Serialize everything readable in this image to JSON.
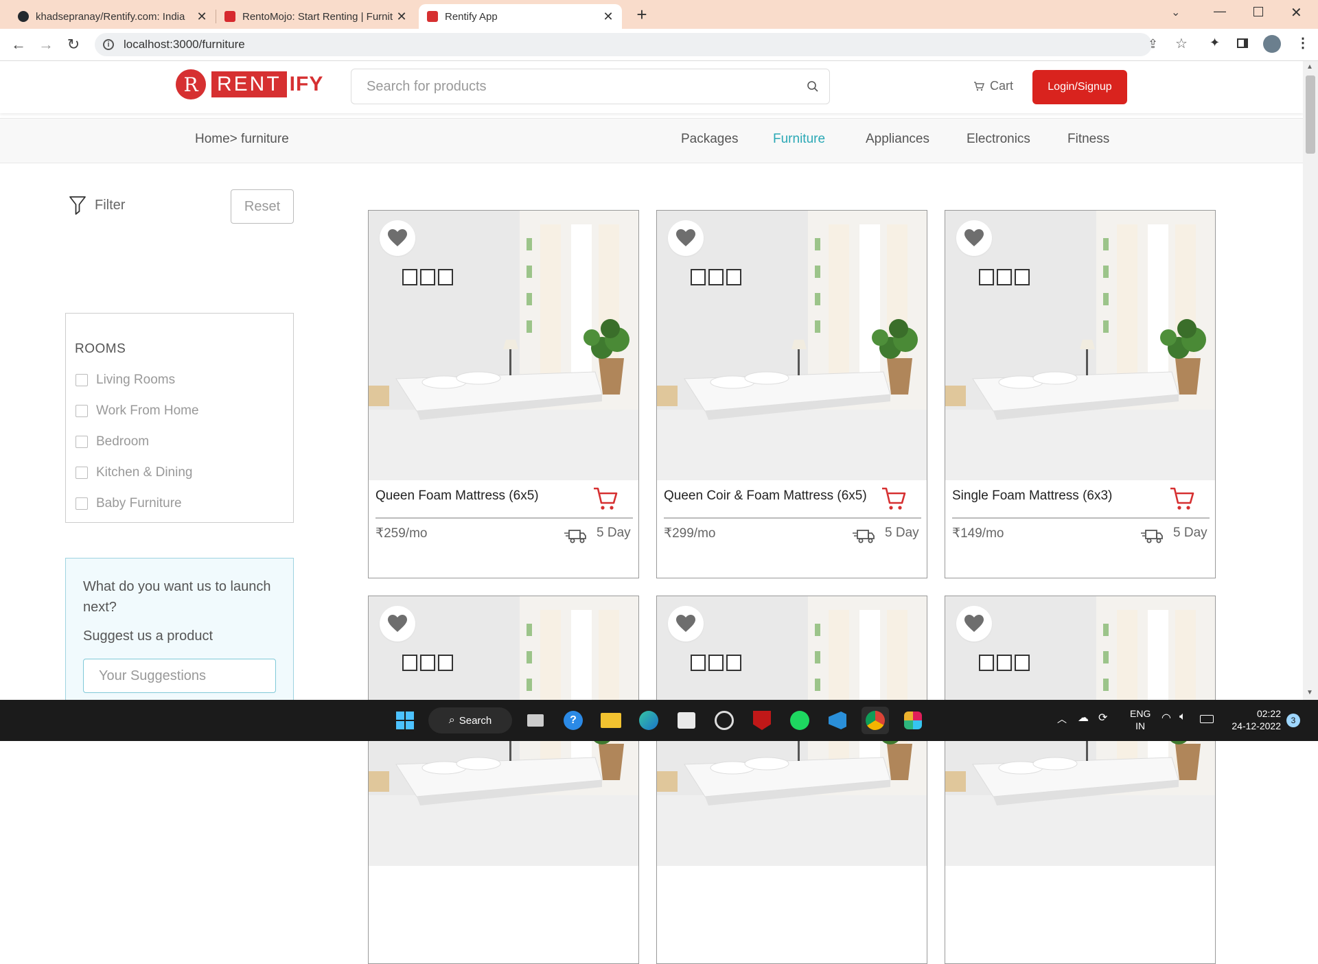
{
  "browser": {
    "tabs": [
      {
        "title": "khadsepranay/Rentify.com: India",
        "favicon_color": "#24292e"
      },
      {
        "title": "RentoMojo: Start Renting | Furnit",
        "favicon_color": "#d6292e"
      },
      {
        "title": "Rentify App",
        "favicon_color": "#d63031"
      }
    ],
    "new_tab": "+",
    "url": "localhost:3000/furniture"
  },
  "header": {
    "logo_letter": "R",
    "logo_rent": "RENT",
    "logo_ify": "IFY",
    "search_placeholder": "Search for products",
    "cart_label": "Cart",
    "login_label": "Login/Signup"
  },
  "nav": {
    "breadcrumb": "Home> furniture",
    "categories": [
      "Packages",
      "Furniture",
      "Appliances",
      "Electronics",
      "Fitness"
    ],
    "active_category": "Furniture"
  },
  "sidebar": {
    "filter_label": "Filter",
    "reset_label": "Reset",
    "rooms_title": "ROOMS",
    "rooms": [
      "Living Rooms",
      "Work From Home",
      "Bedroom",
      "Kitchen & Dining",
      "Baby Furniture"
    ],
    "suggest_question": "What do you want us to launch next?",
    "suggest_label": "Suggest us a product",
    "suggest_placeholder": "Your Suggestions"
  },
  "products": [
    {
      "name": "Queen Foam Mattress (6x5)",
      "price": "₹259/mo",
      "delivery": "5 Day"
    },
    {
      "name": "Queen Coir & Foam Mattress (6x5)",
      "price": "₹299/mo",
      "delivery": "5 Day"
    },
    {
      "name": "Single Foam Mattress (6x3)",
      "price": "₹149/mo",
      "delivery": "5 Day"
    },
    {
      "name": "",
      "price": "",
      "delivery": ""
    },
    {
      "name": "",
      "price": "",
      "delivery": ""
    },
    {
      "name": "",
      "price": "",
      "delivery": ""
    }
  ],
  "taskbar": {
    "search_label": "Search",
    "lang_top": "ENG",
    "lang_bottom": "IN",
    "time": "02:22",
    "date": "24-12-2022",
    "notifications": "3"
  },
  "colors": {
    "brand_red": "#d63031",
    "accent_teal": "#2aa8b5",
    "tab_strip": "#f9dccb"
  }
}
